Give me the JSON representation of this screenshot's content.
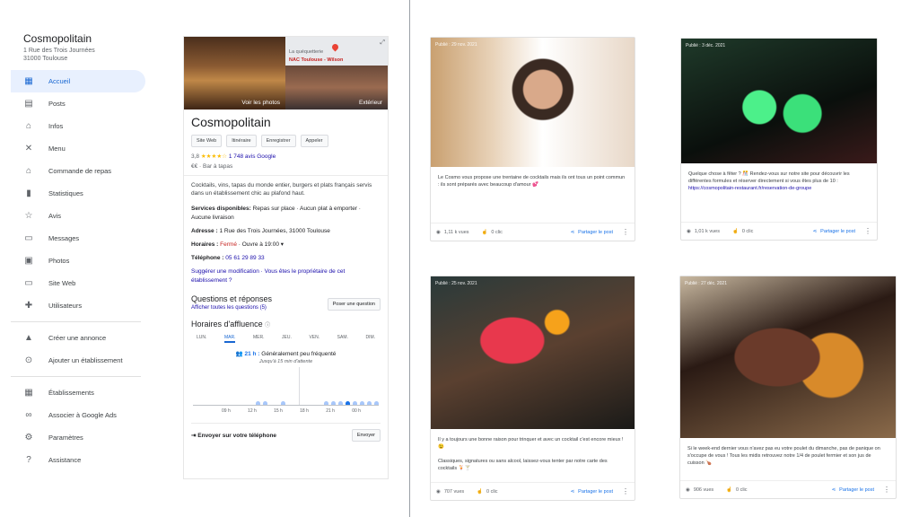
{
  "business": {
    "name": "Cosmopolitain",
    "address_line1": "1 Rue des Trois Journées",
    "address_line2": "31000 Toulouse"
  },
  "nav": {
    "group1": [
      {
        "label": "Accueil",
        "icon": "home-dashboard-icon",
        "active": true
      },
      {
        "label": "Posts",
        "icon": "posts-icon"
      },
      {
        "label": "Infos",
        "icon": "store-icon"
      },
      {
        "label": "Menu",
        "icon": "utensils-icon"
      },
      {
        "label": "Commande de repas",
        "icon": "order-icon"
      },
      {
        "label": "Statistiques",
        "icon": "bar-chart-icon"
      },
      {
        "label": "Avis",
        "icon": "reviews-icon"
      },
      {
        "label": "Messages",
        "icon": "message-icon"
      },
      {
        "label": "Photos",
        "icon": "photo-icon"
      },
      {
        "label": "Site Web",
        "icon": "website-icon"
      },
      {
        "label": "Utilisateurs",
        "icon": "add-user-icon"
      }
    ],
    "group2": [
      {
        "label": "Créer une annonce",
        "icon": "ads-icon"
      },
      {
        "label": "Ajouter un établissement",
        "icon": "location-pin-icon"
      }
    ],
    "group3": [
      {
        "label": "Établissements",
        "icon": "storefront-icon"
      },
      {
        "label": "Associer à Google Ads",
        "icon": "link-icon"
      },
      {
        "label": "Paramètres",
        "icon": "gear-icon"
      },
      {
        "label": "Assistance",
        "icon": "help-icon"
      }
    ]
  },
  "panel": {
    "photo_label": "Voir les photos",
    "map_place": "La quéquetterie",
    "map_poi": "NAC Toulouse - Wilson",
    "exterior_label": "Extérieur",
    "title": "Cosmopolitain",
    "buttons": [
      "Site Web",
      "Itinéraire",
      "Enregistrer",
      "Appeler"
    ],
    "rating_value": "3,8",
    "stars": "★★★★☆",
    "review_count": "1 748 avis Google",
    "price": "€€",
    "category": "Bar à tapas",
    "description": "Cocktails, vins, tapas du monde entier, burgers et plats français servis dans un établissement chic au plafond haut.",
    "services_label": "Services disponibles:",
    "services_value": "Repas sur place · Aucun plat à emporter · Aucune livraison",
    "address_label": "Adresse :",
    "address_value": "1 Rue des Trois Journées, 31000 Toulouse",
    "hours_label": "Horaires :",
    "hours_status": "Fermé",
    "hours_open": "· Ouvre à 19:00 ▾",
    "phone_label": "Téléphone :",
    "phone_value": "05 61 29 89 33",
    "suggest": "Suggérer une modification · Vous êtes le propriétaire de cet établissement ?",
    "qa_title": "Questions et réponses",
    "qa_link": "Afficher toutes les questions (5)",
    "ask_button": "Poser une question",
    "popular_title": "Horaires d'affluence",
    "days": [
      "LUN.",
      "MAR.",
      "MER.",
      "JEU.",
      "VEN.",
      "SAM.",
      "DIM."
    ],
    "selected_day": "MAR.",
    "busy_time": "21 h :",
    "busy_text": "Généralement peu fréquenté",
    "wait_text": "Jusqu'à 15 min d'attente",
    "hours_axis": [
      "09 h",
      "12 h",
      "15 h",
      "18 h",
      "21 h",
      "00 h"
    ],
    "send_label": "Envoyer sur votre téléphone",
    "send_button": "Envoyer"
  },
  "posts": [
    {
      "date": "Publié : 29 nov. 2021",
      "text": "Le Cosmo vous propose une trentaine de cocktails mais ils ont tous un point commun : ils sont préparés avec beaucoup d'amour 💕",
      "views": "1,11 k vues",
      "clicks": "0 clic",
      "share": "Partager le post"
    },
    {
      "date": "Publié : 3 déc. 2021",
      "text": "Quelque chose à fêter ? 🎊 Rendez-vous sur notre site pour découvrir les différentes formules et réserver directement si vous êtes plus de 10 :",
      "link": "https://cosmopolitain-restaurant.fr/reservation-de-groupe",
      "views": "1,01 k vues",
      "clicks": "0 clic",
      "share": "Partager le post"
    },
    {
      "date": "Publié : 25 nov. 2021",
      "text": "Il y a toujours une bonne raison pour trinquer et avec un cocktail c'est encore mieux ! 😉",
      "text2": "Classiques, signatures ou sans alcool, laissez-vous tenter par notre carte des cocktails 🍹🍸",
      "views": "707 vues",
      "clicks": "0 clic",
      "share": "Partager le post"
    },
    {
      "date": "Publié : 27 déc. 2021",
      "text": "Si le week-end dernier vous n'avez pas eu votre poulet du dimanche, pas de panique on s'occupe de vous ! Tous les midis retrouvez notre 1/4 de poulet fermier et son jus de cuisson 🍗",
      "views": "906 vues",
      "clicks": "0 clic",
      "share": "Partager le post"
    }
  ],
  "colors": {
    "accent": "#1a73e8",
    "active_bg": "#e8f0fe",
    "closed": "#c5221f",
    "star": "#fbbc04"
  }
}
